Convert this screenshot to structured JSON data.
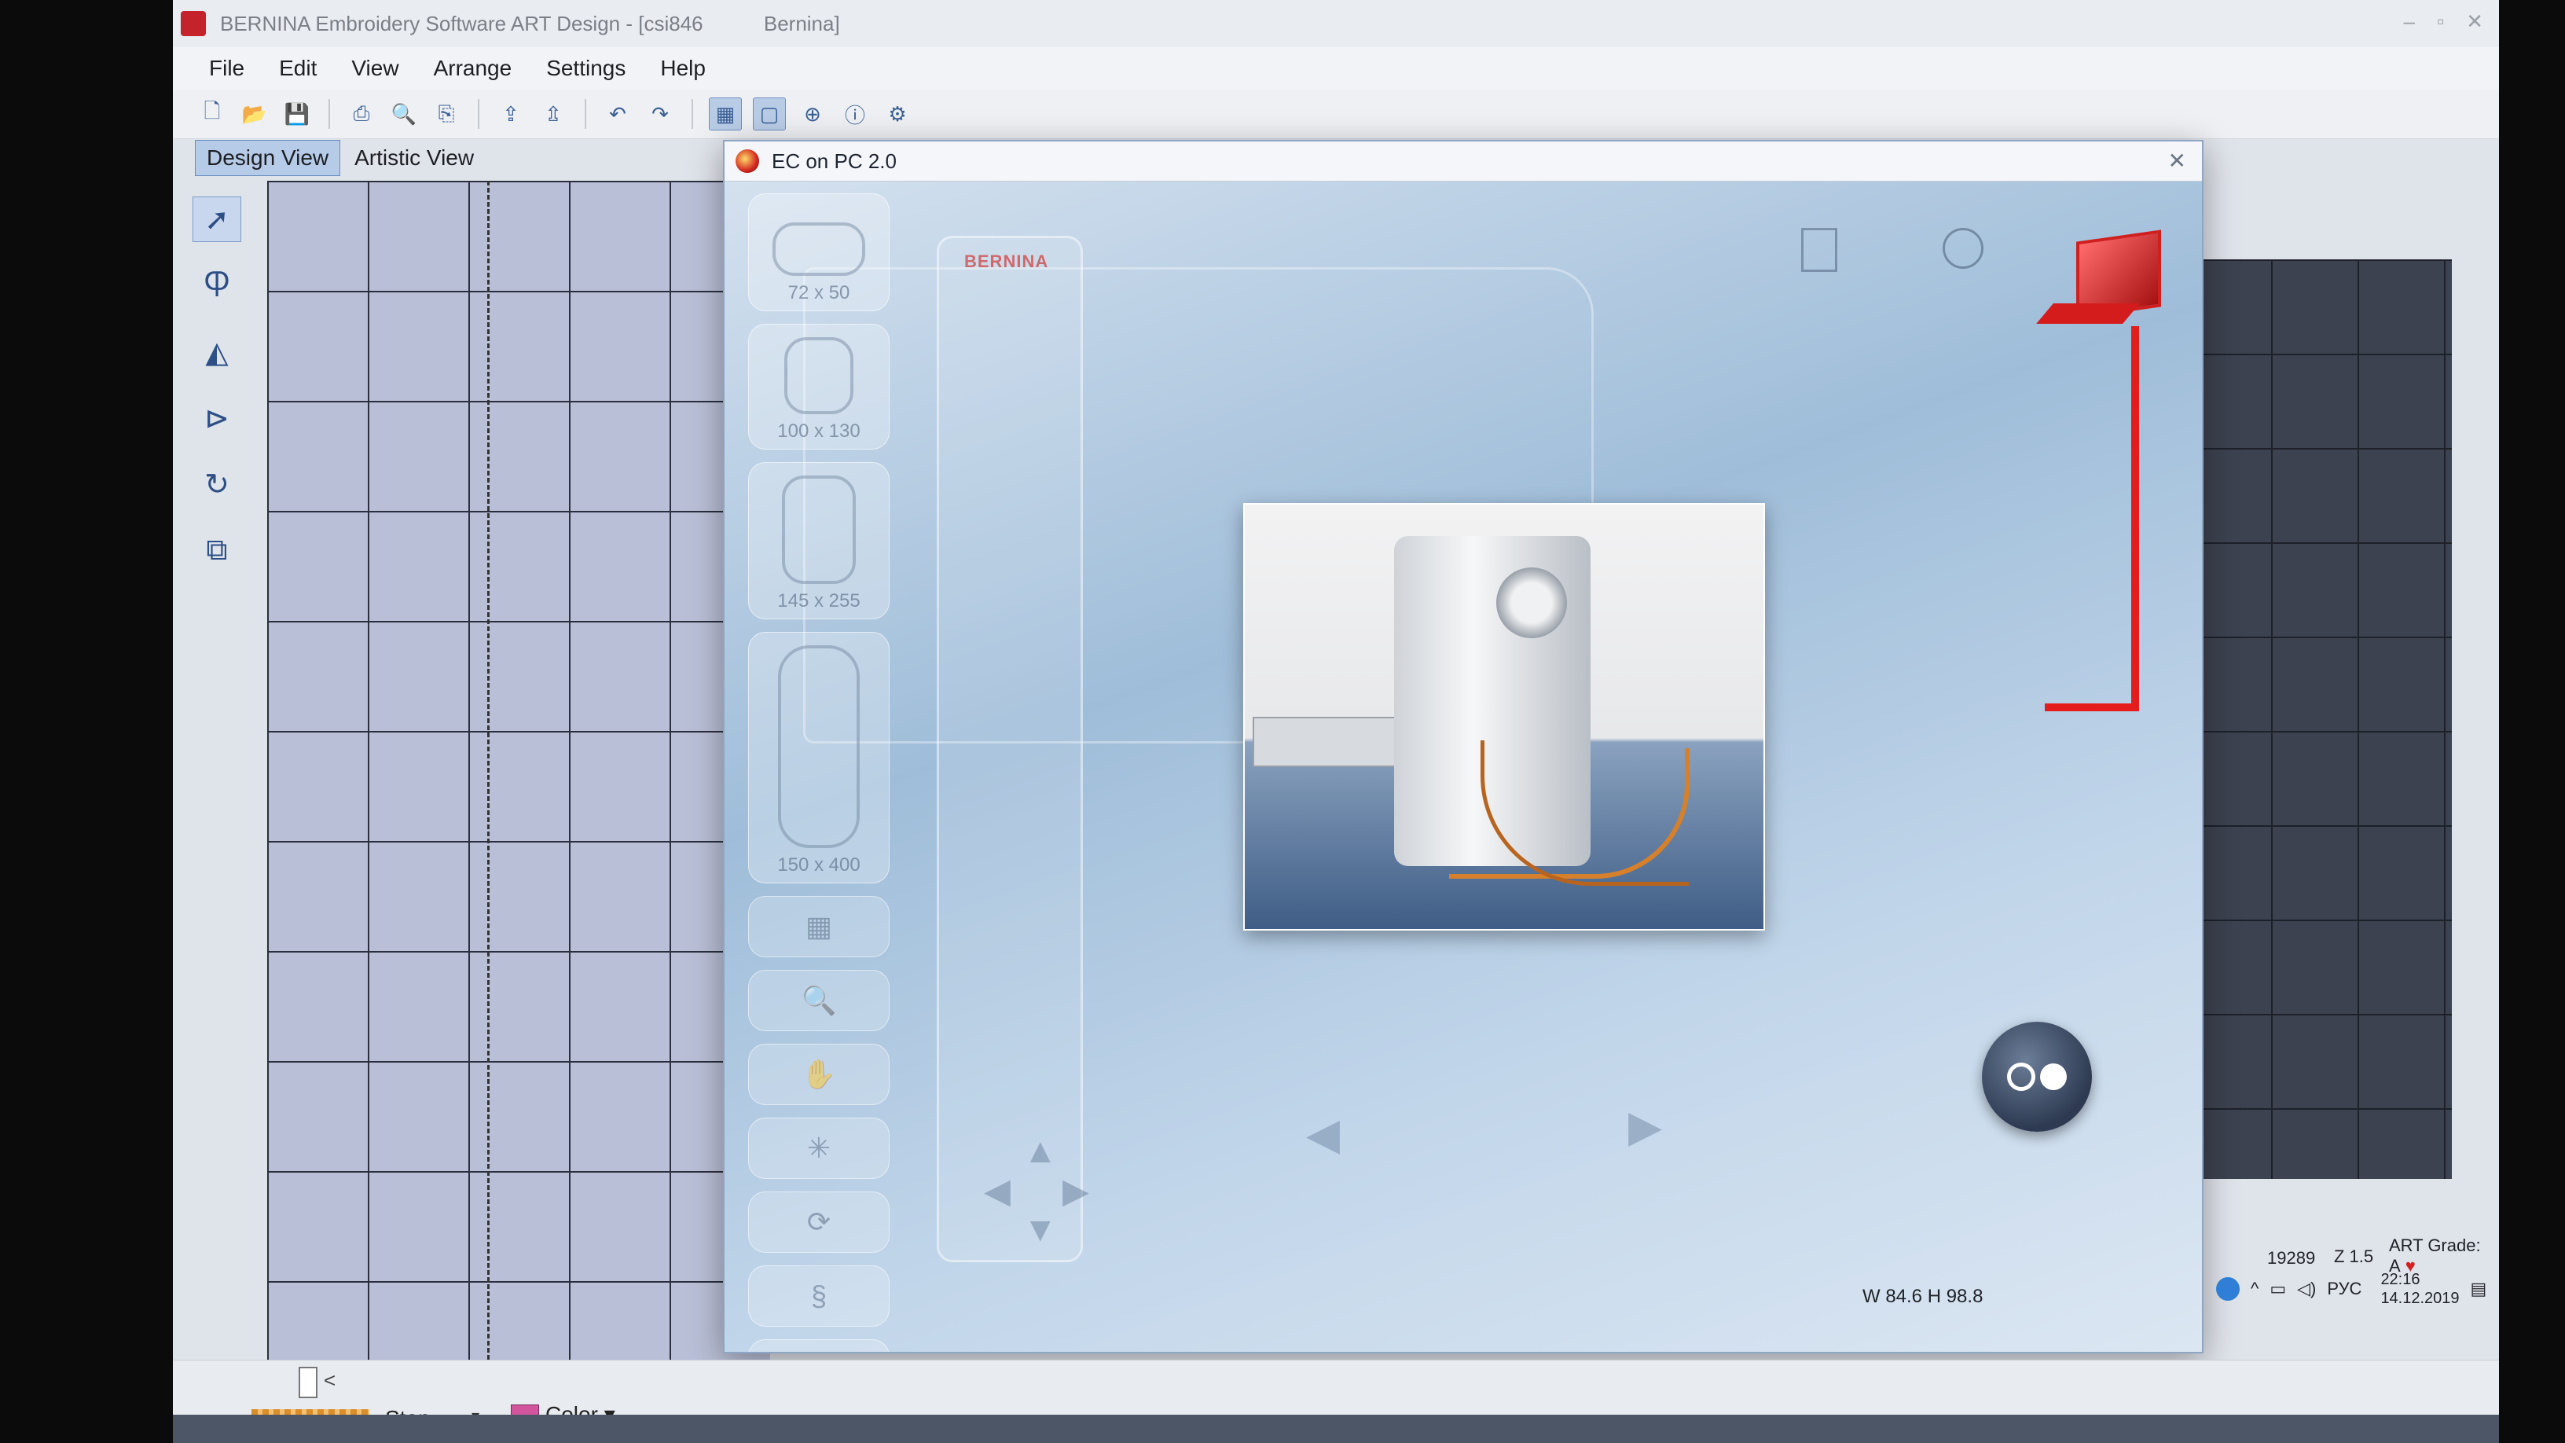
{
  "window": {
    "title": "BERNINA Embroidery Software ART Design - [csi846",
    "title_suffix": "Bernina]"
  },
  "menu": [
    "File",
    "Edit",
    "View",
    "Arrange",
    "Settings",
    "Help"
  ],
  "view_tabs": [
    "Design View",
    "Artistic View"
  ],
  "ec_window": {
    "title": "EC on PC 2.0",
    "brand": "BERNINA",
    "hoops": [
      "72 x 50",
      "100 x 130",
      "145 x 255",
      "150 x 400"
    ]
  },
  "status": {
    "step_label": "Step",
    "color_label": "Color",
    "dimensions": "W 84.6 H 98.8",
    "stitches": "19289",
    "zoom": "Z 1.5",
    "grade": "ART Grade: A",
    "lang": "РУС",
    "time": "22:16",
    "date": "14.12.2019"
  }
}
